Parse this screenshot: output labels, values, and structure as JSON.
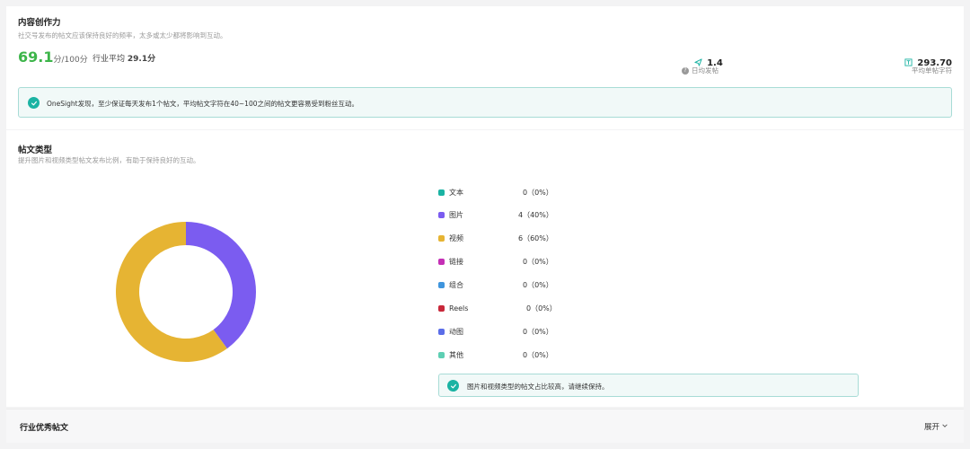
{
  "creativity": {
    "title": "内容创作力",
    "subtitle": "社交号发布的帖文应该保持良好的频率，太多或太少都将影响到互动。",
    "score": "69.1",
    "score_unit": "分/100分",
    "industry_label": "行业平均",
    "industry_value": "29.1分",
    "stats": [
      {
        "icon": "send-icon",
        "value": "1.4",
        "label": "日均发帖",
        "has_help": true
      },
      {
        "icon": "text-icon",
        "value": "293.70",
        "label": "平均单帖字符",
        "has_help": false
      }
    ],
    "insight": "OneSight发现，至少保证每天发布1个帖文，平均帖文字符在40~100之间的帖文更容易受到粉丝互动。"
  },
  "post_types": {
    "title": "帖文类型",
    "subtitle": "提升图片和视频类型帖文发布比例，有助于保持良好的互动。",
    "tip": "图片和视频类型的帖文占比较高，请继续保持。"
  },
  "chart_data": {
    "type": "pie",
    "donut": true,
    "categories": [
      "文本",
      "图片",
      "视频",
      "链接",
      "组合",
      "Reels",
      "动图",
      "其他"
    ],
    "values": [
      0,
      4,
      6,
      0,
      0,
      0,
      0,
      0
    ],
    "labels": [
      "0（0%）",
      "4（40%）",
      "6（60%）",
      "0（0%）",
      "0（0%）",
      "0（0%）",
      "0（0%）",
      "0（0%）"
    ],
    "colors": [
      "#1bb3a3",
      "#7b5cf0",
      "#e6b433",
      "#c42fb5",
      "#3f95dd",
      "#c8283a",
      "#5b6de8",
      "#5ecfb3"
    ],
    "legend": "right"
  },
  "industry_posts": {
    "title": "行业优秀帖文",
    "expand_label": "展开"
  }
}
